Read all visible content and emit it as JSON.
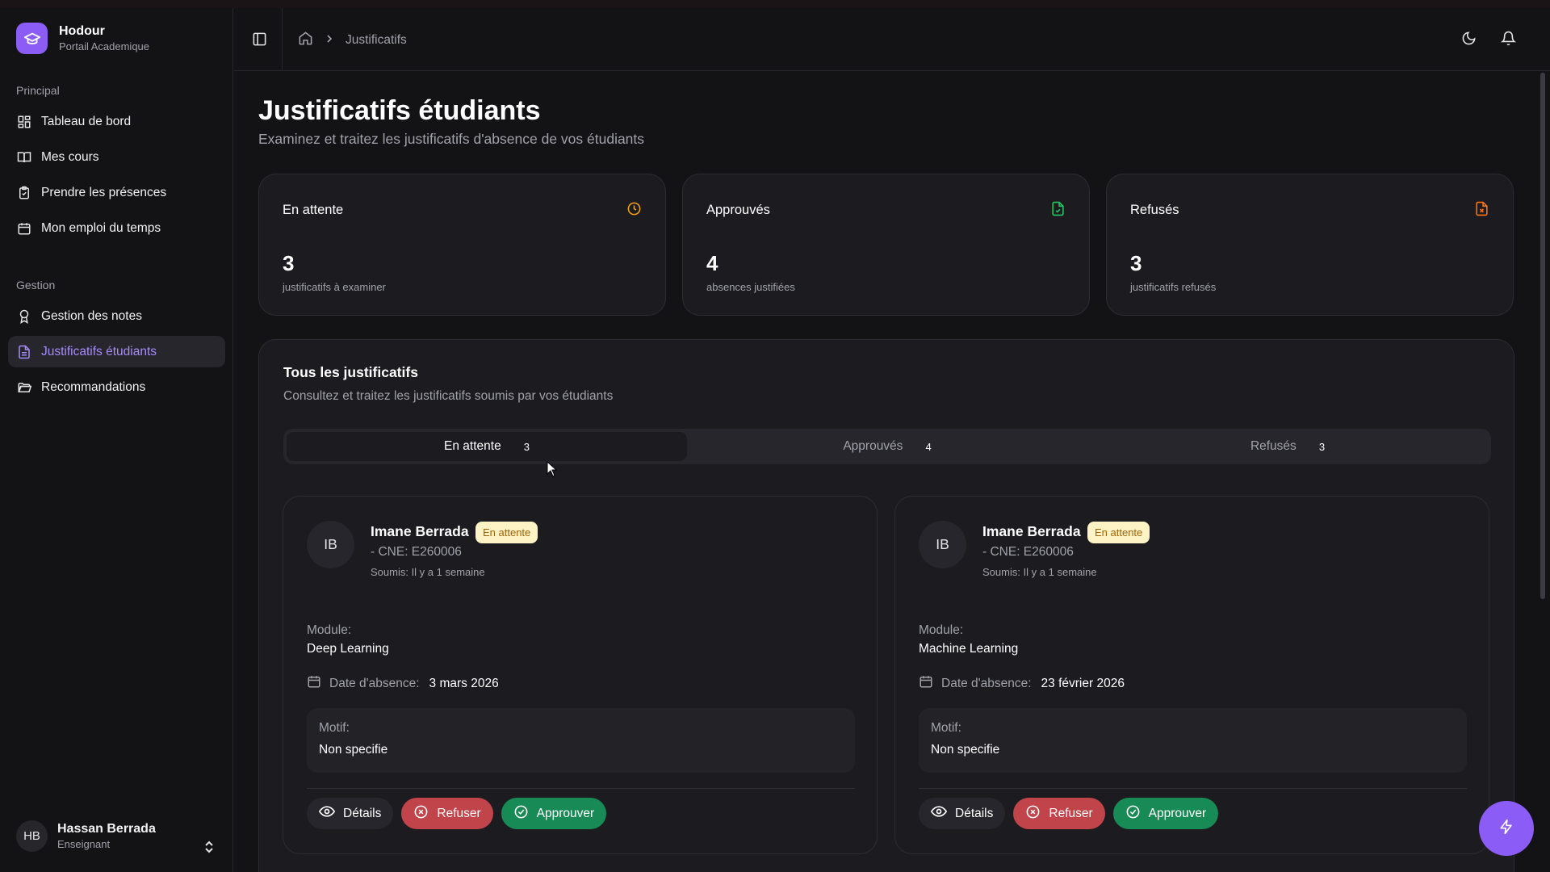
{
  "brand": {
    "name": "Hodour",
    "subtitle": "Portail Academique"
  },
  "sidebar": {
    "section_principal": "Principal",
    "section_gestion": "Gestion",
    "items": [
      {
        "label": "Tableau de bord",
        "icon": "dashboard-icon"
      },
      {
        "label": "Mes cours",
        "icon": "book-icon"
      },
      {
        "label": "Prendre les présences",
        "icon": "clipboard-check-icon"
      },
      {
        "label": "Mon emploi du temps",
        "icon": "calendar-icon"
      },
      {
        "label": "Gestion des notes",
        "icon": "award-icon"
      },
      {
        "label": "Justificatifs étudiants",
        "icon": "file-text-icon",
        "active": true
      },
      {
        "label": "Recommandations",
        "icon": "folder-open-icon"
      }
    ]
  },
  "user": {
    "initials": "HB",
    "name": "Hassan Berrada",
    "role": "Enseignant"
  },
  "header": {
    "breadcrumb_current": "Justificatifs"
  },
  "page": {
    "title": "Justificatifs étudiants",
    "subtitle": "Examinez et traitez les justificatifs d'absence de vos étudiants"
  },
  "stats": [
    {
      "title": "En attente",
      "value": "3",
      "desc": "justificatifs à examiner",
      "icon": "clock-icon",
      "color": "#f59e0b"
    },
    {
      "title": "Approuvés",
      "value": "4",
      "desc": "absences justifiées",
      "icon": "file-check-icon",
      "color": "#22c55e"
    },
    {
      "title": "Refusés",
      "value": "3",
      "desc": "justificatifs refusés",
      "icon": "file-x-icon",
      "color": "#f97316"
    }
  ],
  "list": {
    "title": "Tous les justificatifs",
    "subtitle": "Consultez et traitez les justificatifs soumis par vos étudiants",
    "tabs": [
      {
        "label": "En attente",
        "count": "3",
        "active": true
      },
      {
        "label": "Approuvés",
        "count": "4"
      },
      {
        "label": "Refusés",
        "count": "3"
      }
    ]
  },
  "requests": [
    {
      "initials": "IB",
      "name": "Imane Berrada",
      "status": "En attente",
      "cne": "- CNE: E260006",
      "submitted": "Soumis: Il y a 1 semaine",
      "module_label": "Module:",
      "module": "Deep Learning",
      "date_label": "Date d'absence:",
      "date": "3 mars 2026",
      "motif_label": "Motif:",
      "motif": "Non specifie"
    },
    {
      "initials": "IB",
      "name": "Imane Berrada",
      "status": "En attente",
      "cne": "- CNE: E260006",
      "submitted": "Soumis: Il y a 1 semaine",
      "module_label": "Module:",
      "module": "Machine Learning",
      "date_label": "Date d'absence:",
      "date": "23 février 2026",
      "motif_label": "Motif:",
      "motif": "Non specifie"
    }
  ],
  "actions": {
    "details": "Détails",
    "refuse": "Refuser",
    "approve": "Approuver"
  },
  "colors": {
    "accent": "#8b5cf6",
    "pending_badge_bg": "#fdf3c4",
    "refuse": "#c0444a",
    "approve": "#188a55"
  }
}
